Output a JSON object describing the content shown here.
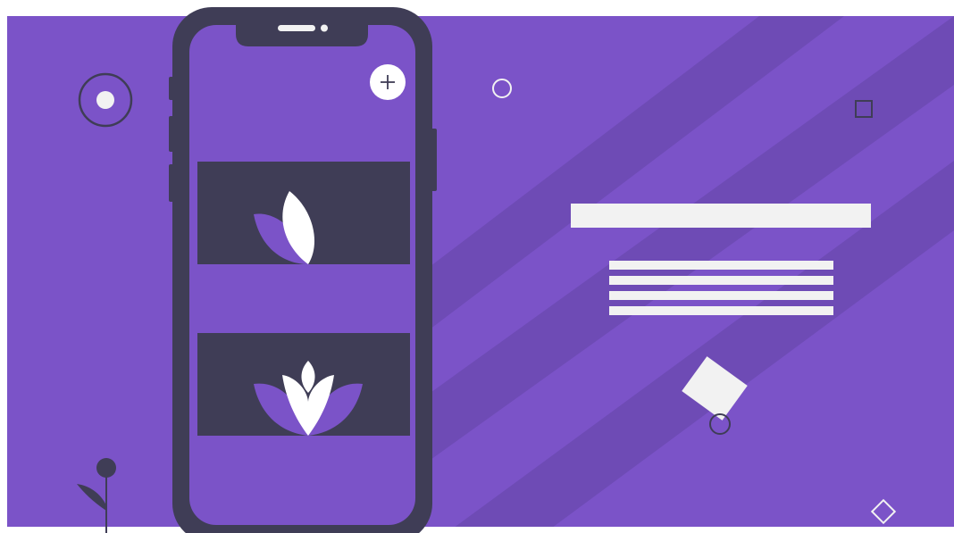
{
  "illustration": {
    "description_colors": {
      "background": "#ffffff",
      "panel": "#7b53c8",
      "stripe": "#6e4bb5",
      "phone_body": "#3f3d56",
      "screen": "#7b53c8",
      "accent_light": "#f2f2f2",
      "white": "#ffffff"
    },
    "icons": {
      "add": "plus-icon",
      "leaf": "leaf-icon",
      "lotus": "lotus-icon"
    }
  }
}
